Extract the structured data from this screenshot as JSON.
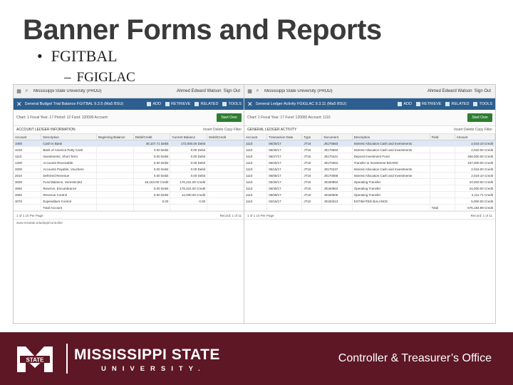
{
  "slide": {
    "title": "Banner Forms and Reports",
    "bullet_level1": "FGITBAL",
    "bullet_level2": "FGIGLAC",
    "bullet_char": "•",
    "dash_char": "–"
  },
  "left_screen": {
    "app_title": "Mississippi State University (PROD)",
    "user": "Ahmed Edward Watson",
    "signout": "Sign Out",
    "form_name": "General Budget Trial Balance FGITBAL 9.3.5 (Ma5 BSU)",
    "toolbar": [
      "ADD",
      "RETRIEVE",
      "RELATED",
      "TOOLS"
    ],
    "key_text": "Chart: 1   Fiscal Year: 17   Period: 12   Fund: 120000   Account:",
    "start_over": "Start Over",
    "section": "ACCOUNT   LEDGER INFORMATION",
    "section_tools": "Insert   Delete   Copy   Filter",
    "columns": [
      "Account",
      "Description",
      "Beginning Balance",
      "Debit/Credit",
      "Current Balance",
      "Debit/Credit"
    ],
    "rows": [
      [
        "1000",
        "Cash in Bank",
        "",
        "48,107.71 Debit",
        "172,000.00 Debit",
        ""
      ],
      [
        "1010",
        "Bank of America Petty Cash",
        "",
        "0.00 Debit",
        "0.00 Debit",
        ""
      ],
      [
        "1110",
        "Investments, Short Term",
        "",
        "0.00 Debit",
        "0.00 Debit",
        ""
      ],
      [
        "1200",
        "Accounts Receivable",
        "",
        "0.00 Debit",
        "0.00 Debit",
        ""
      ],
      [
        "2000",
        "Accounts Payable, Vouchers",
        "",
        "0.00 Debit",
        "0.00 Debit",
        ""
      ],
      [
        "2010",
        "Deferred Revenue",
        "",
        "0.00 Debit",
        "0.00 Debit",
        ""
      ],
      [
        "3000",
        "Fund Balance, Unrestricted",
        "",
        "46,153.00 Credit",
        "176,431.00 Credit",
        ""
      ],
      [
        "3050",
        "Reserve, Encumbrance",
        "",
        "0.00 Debit",
        "176,431.00 Credit",
        ""
      ],
      [
        "3060",
        "Revenue Control",
        "",
        "0.00 Debit",
        "12,000.00 Credit",
        ""
      ],
      [
        "3070",
        "Expenditure Control",
        "",
        "0.00",
        "0.00",
        ""
      ],
      [
        "",
        "Total Account",
        "",
        "",
        "",
        ""
      ]
    ],
    "pager": "1 of 1   10 Per Page",
    "record": "Record: 1 of 11",
    "url": "www.msstate.edu/dept/controller"
  },
  "right_screen": {
    "app_title": "Mississippi State University (PROD)",
    "user": "Ahmed Edward Watson",
    "signout": "Sign Out",
    "form_name": "General Ledger Activity FGIGLAC 9.3.11 (Ma5 BSU)",
    "toolbar": [
      "ADD",
      "RETRIEVE",
      "RELATED",
      "TOOLS"
    ],
    "key_text": "Chart: 1   Fiscal Year: 17   Fund: 120000   Account: 1110",
    "start_over": "Start Over",
    "section": "GENERAL LEDGER ACTIVITY",
    "section_tools": "Insert   Delete   Copy   Filter",
    "columns": [
      "Account",
      "Transaction Date",
      "Type",
      "Document",
      "Description",
      "Field",
      "Amount"
    ],
    "rows": [
      [
        "1110",
        "06/30/17",
        "JT16",
        "J0170583",
        "Interest Allocation Cash and Investments",
        "",
        "2,019.10 Credit"
      ],
      [
        "1110",
        "06/30/17",
        "JT16",
        "J0170583",
        "Interest Allocation Cash and Investments",
        "",
        "2,020.00 Credit"
      ],
      [
        "1110",
        "06/27/17",
        "JT16",
        "J0170421",
        "Deposit Investment Fund",
        "",
        "458,000.00 Credit"
      ],
      [
        "1110",
        "06/20/17",
        "JT16",
        "J0170362",
        "Transfer to Investment BOARD",
        "",
        "157,000.00 Credit"
      ],
      [
        "1110",
        "06/15/17",
        "JT16",
        "J0170237",
        "Interest Allocation Cash and Investments",
        "",
        "2,016.00 Credit"
      ],
      [
        "1110",
        "06/05/17",
        "JT16",
        "J0170068",
        "Interest Allocation Cash and Investments",
        "",
        "2,019.10 Credit"
      ],
      [
        "1110",
        "05/30/17",
        "JT16",
        "J0160953",
        "Operating Transfer",
        "",
        "24,000.00 Credit"
      ],
      [
        "1110",
        "05/30/17",
        "JT16",
        "J0160952",
        "Operating Transfer",
        "",
        "24,000.00 Credit"
      ],
      [
        "1110",
        "05/09/17",
        "JT16",
        "J0160605",
        "Operating Transfer",
        "",
        "2,111.71 Credit"
      ],
      [
        "1110",
        "02/16/17",
        "JT22",
        "J0150313",
        "ESTIMATED BALANCE",
        "",
        "5,000.00 Credit"
      ],
      [
        "",
        "",
        "",
        "",
        "",
        "Total",
        "676,184.89 Credit"
      ]
    ],
    "pager": "1 of 1   10 Per Page",
    "record": "Record: 1 of 11"
  },
  "footer": {
    "university_line1": "MISSISSIPPI STATE",
    "university_line2": "UNIVERSITY.",
    "logo_mark": "STATE",
    "office": "Controller & Treasurer’s Office",
    "maroon": "#5d1725"
  }
}
